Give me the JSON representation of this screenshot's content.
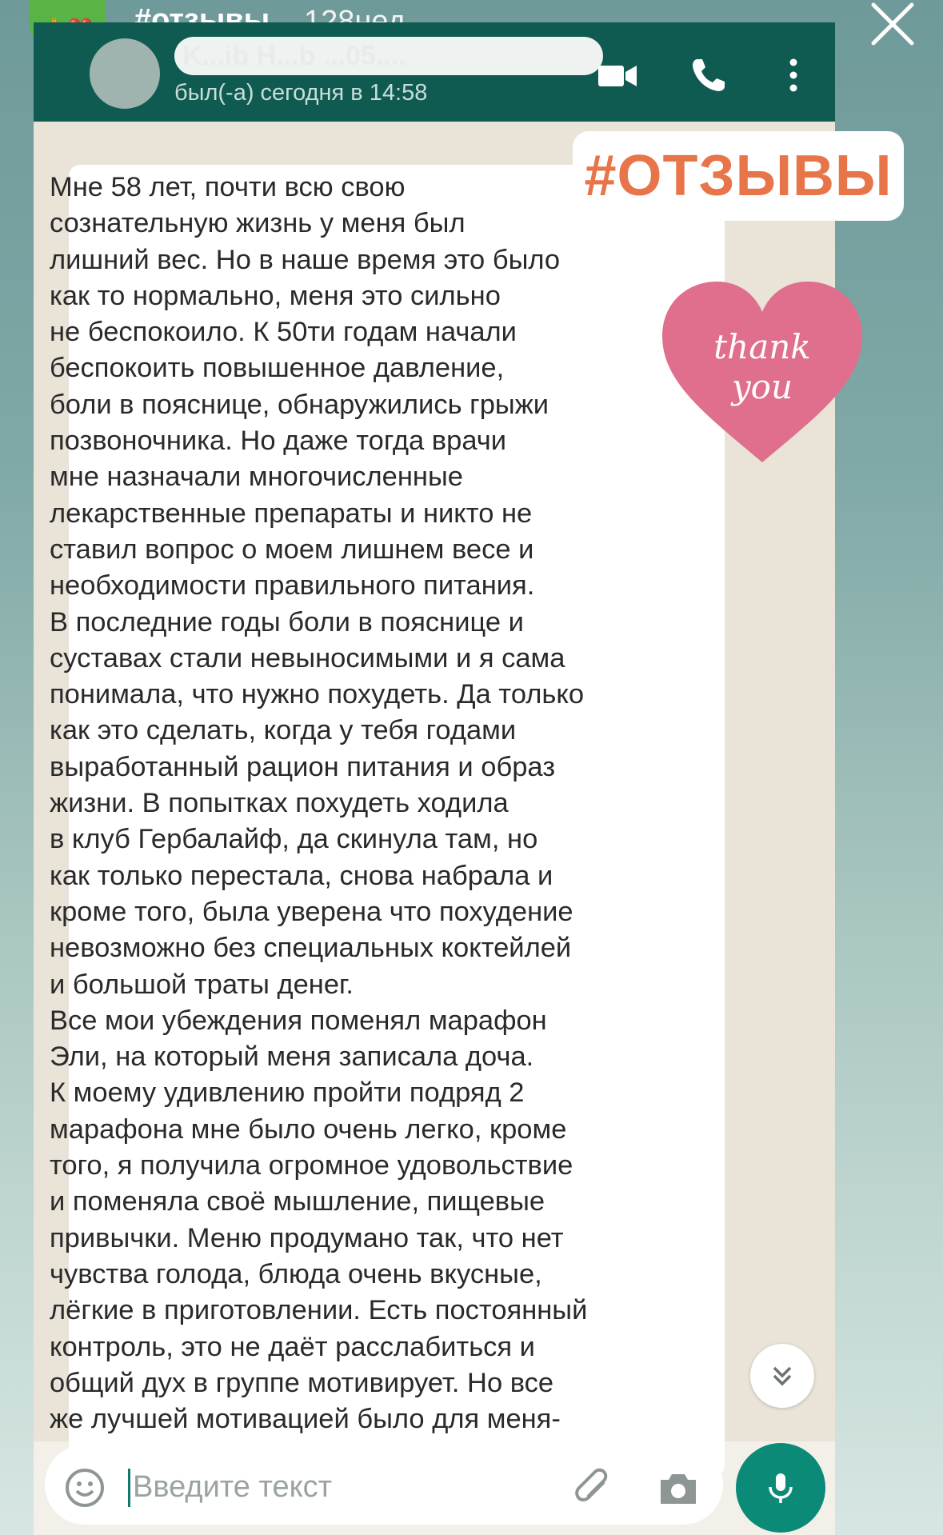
{
  "story": {
    "avatar_emoji": "🙏❤️",
    "title": "#отзывы",
    "time_ago": "128нед."
  },
  "chat": {
    "contact_name": "K...ib H...b  ...05....",
    "contact_status": "был(-а) сегодня в 14:58",
    "header_color": "#0f5b52",
    "icons": [
      "video-call-icon",
      "phone-icon",
      "more-vert-icon"
    ]
  },
  "stickers": {
    "hashtag": "#ОТЗЫВЫ",
    "heart_line1": "thank",
    "heart_line2": "you"
  },
  "message": {
    "text": "Мне 58 лет, почти всю свою\nсознательную жизнь у меня был\nлишний вес. Но в наше время это было\nкак то нормально, меня это сильно\nне беспокоило. К 50ти годам начали\nбеспокоить повышенное давление,\nболи в пояснице, обнаружились грыжи\nпозвоночника. Но даже тогда врачи\nмне  назначали многочисленные\nлекарственные препараты и никто не\nставил вопрос о моем лишнем весе и\nнеобходимости правильного питания.\nВ последние годы боли в пояснице и\nсуставах  стали невыносимыми и я сама\nпонимала, что нужно похудеть. Да только\nкак это сделать, когда у тебя годами\nвыработанный рацион питания и образ\nжизни. В попытках похудеть ходила\nв клуб Гербалайф, да скинула там, но\nкак только перестала, снова набрала и\nкроме того, была уверена что похудение\nневозможно без специальных коктейлей\nи большой траты денег.\nВсе мои убеждения поменял марафон\nЭли, на который меня записала доча.\nК моему удивлению пройти подряд 2\nмарафона мне было очень легко, кроме\nтого, я получила огромное удовольствие\nи поменяла своё мышление, пищевые\nпривычки. Меню продумано так, что  нет\nчувства голода, блюда очень вкусные,\nлёгкие в приготовлении. Есть постоянный\nконтроль, это не даёт расслабиться и\nобщий дух в группе мотивирует. Но все\nже лучшей мотивацией было для меня-"
  },
  "input": {
    "placeholder": "Введите текст"
  },
  "colors": {
    "accent": "#0b8a77",
    "hashtag": "#e8754a",
    "heart": "#df6f8d"
  }
}
